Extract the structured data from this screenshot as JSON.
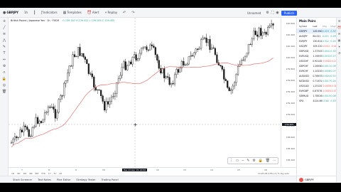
{
  "toolbar": {
    "symbol": "GBPJPY",
    "interval": "1h",
    "items": [
      "Indicators",
      "Templates",
      "Alert",
      "Replay",
      "Unnamed"
    ],
    "publish_label": "Publish"
  },
  "legend": {
    "title": "British Pound / Japanese Yen · 1h · FXCM",
    "ohlc": "O 139.347  H 139.421  L 139.285  C 139.405"
  },
  "price_axis": {
    "labels": [
      "140.600",
      "140.400",
      "140.200",
      "140.000",
      "139.800",
      "139.600",
      "139.400",
      "139.200",
      "139.000",
      "138.800",
      "138.600",
      "138.400",
      "138.200"
    ],
    "current": "139.405"
  },
  "time_axis": {
    "labels": [
      "7",
      "8",
      "9",
      "10",
      "11",
      "12",
      "13",
      "14",
      "15",
      "16"
    ],
    "crosshair_time": "Tue 13 Apr '21  14:00"
  },
  "bottom_nav": {
    "ranges": [
      "1D",
      "5D",
      "1M",
      "3M",
      "6M",
      "YTD",
      "1Y",
      "5Y",
      "All"
    ],
    "right_info": "14:25:06 (UTC+1)  %  log  auto"
  },
  "status_bar": {
    "items": [
      "Stock Screener",
      "Text Notes",
      "Pine Editor",
      "Strategy Tester",
      "Trading Panel"
    ]
  },
  "watchlist": {
    "title": "Main Pairs",
    "headers": [
      "Symbol",
      "Last",
      "Chg",
      "Chg%"
    ],
    "rows": [
      {
        "sym": "GBPJPY",
        "last": "149.960",
        "chg": "0.453",
        "pct": "0.30%",
        "dir": "up",
        "active": true
      },
      {
        "sym": "AUDJPY",
        "last": "84.021",
        "chg": "0.221",
        "pct": "0.26%",
        "dir": "up",
        "active": false
      },
      {
        "sym": "EURJPY",
        "last": "130.614",
        "chg": "0.312",
        "pct": "0.24%",
        "dir": "up",
        "active": false
      },
      {
        "sym": "USDJPY",
        "last": "109.220",
        "chg": "-0.041",
        "pct": "-0.04%",
        "dir": "dn",
        "active": false
      },
      {
        "sym": "GBPUSD",
        "last": "1.37345",
        "chg": "0.0041",
        "pct": "0.30%",
        "dir": "up",
        "active": false
      },
      {
        "sym": "EURUSD",
        "last": "1.19593",
        "chg": "0.0032",
        "pct": "0.27%",
        "dir": "up",
        "active": false
      },
      {
        "sym": "USDCHF",
        "last": "0.92145",
        "chg": "-0.0022",
        "pct": "-0.24%",
        "dir": "dn",
        "active": false
      },
      {
        "sym": "GBPCHF",
        "last": "1.26560",
        "chg": "0.0011",
        "pct": "0.09%",
        "dir": "up",
        "active": false
      },
      {
        "sym": "EURCHF",
        "last": "1.10200",
        "chg": "0.0008",
        "pct": "0.07%",
        "dir": "up",
        "active": false
      },
      {
        "sym": "AUDUSD",
        "last": "0.76933",
        "chg": "0.0024",
        "pct": "0.31%",
        "dir": "up",
        "active": false
      },
      {
        "sym": "NZDUSD",
        "last": "0.71451",
        "chg": "0.0017",
        "pct": "0.24%",
        "dir": "up",
        "active": false
      },
      {
        "sym": "USDCAD",
        "last": "1.25120",
        "chg": "-0.0039",
        "pct": "-0.31%",
        "dir": "dn",
        "active": false
      },
      {
        "sym": "EURGBP",
        "last": "0.87076",
        "chg": "-0.0003",
        "pct": "-0.03%",
        "dir": "dn",
        "active": false
      },
      {
        "sym": "GBPAUD",
        "last": "1.78526",
        "chg": "0.0015",
        "pct": "0.08%",
        "dir": "up",
        "active": false
      },
      {
        "sym": "SPX",
        "last": "4124.66",
        "chg": "13.60",
        "pct": "0.33%",
        "dir": "up",
        "active": false
      }
    ],
    "bottom_symbol": "GBPJPY"
  },
  "colors": {
    "up": "#26a69a",
    "down": "#ef5350",
    "ma": "#e57373",
    "accent": "#2962ff"
  }
}
